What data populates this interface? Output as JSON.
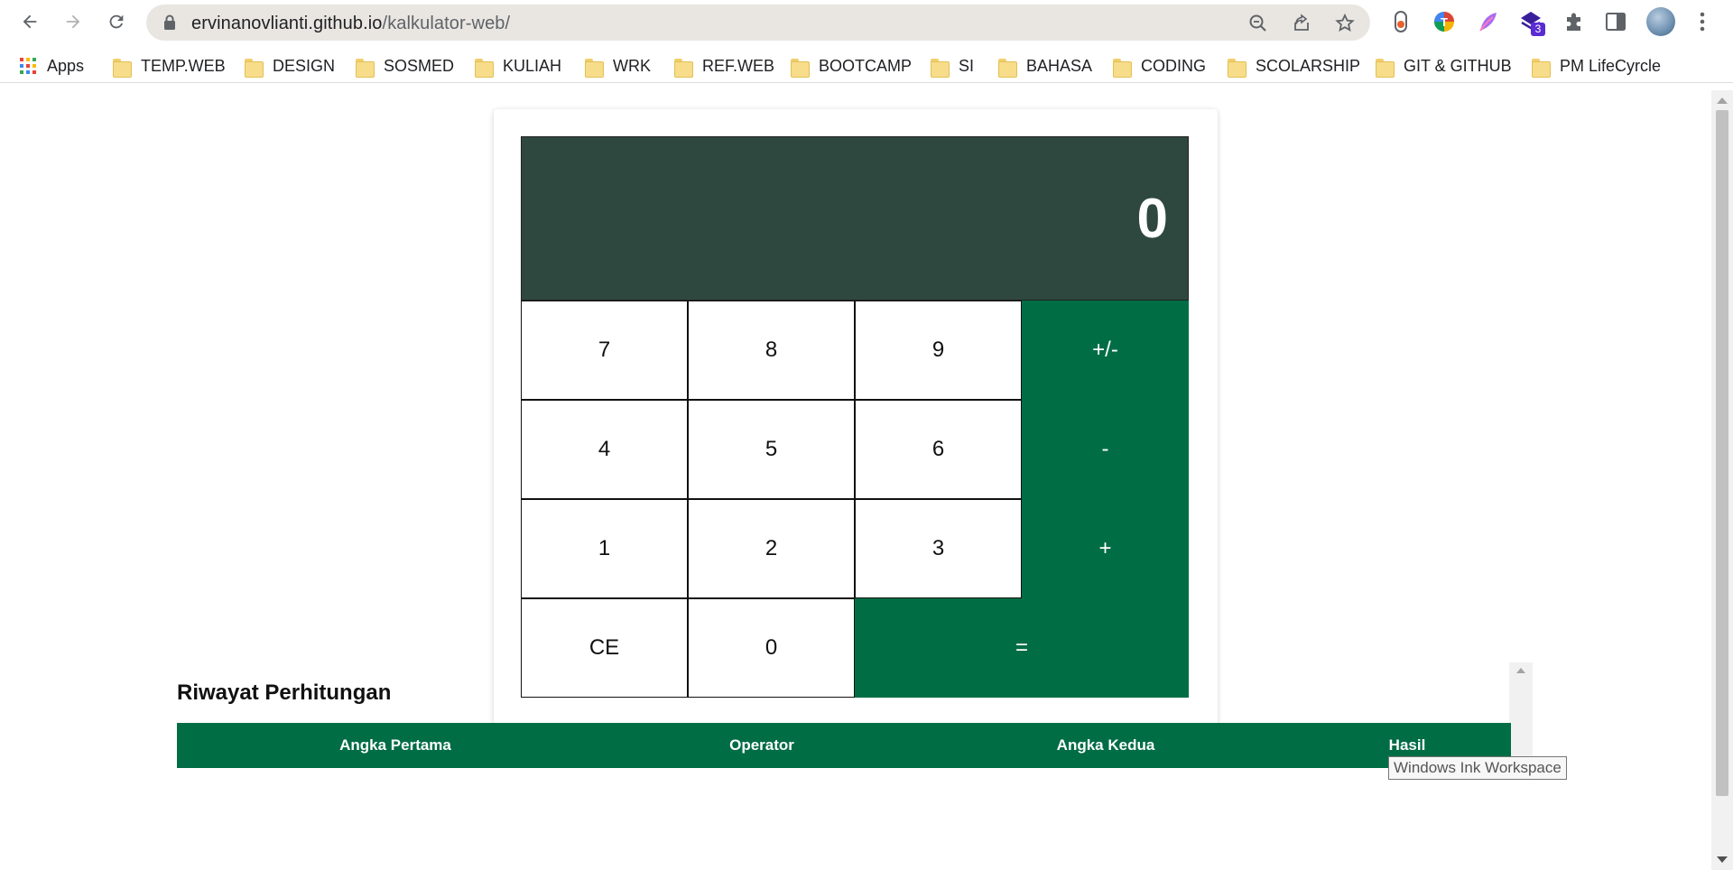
{
  "browser": {
    "url_host": "ervinanovlianti.github.io",
    "url_path": "/kalkulator-web/",
    "bookmarks": [
      {
        "label": "Apps",
        "icon": "apps-grid-icon"
      },
      {
        "label": "TEMP.WEB",
        "icon": "folder-icon"
      },
      {
        "label": "DESIGN",
        "icon": "folder-icon"
      },
      {
        "label": "SOSMED",
        "icon": "folder-icon"
      },
      {
        "label": "KULIAH",
        "icon": "folder-icon"
      },
      {
        "label": "WRK",
        "icon": "folder-icon"
      },
      {
        "label": "REF.WEB",
        "icon": "folder-icon"
      },
      {
        "label": "BOOTCAMP",
        "icon": "folder-icon"
      },
      {
        "label": "SI",
        "icon": "folder-icon"
      },
      {
        "label": "BAHASA",
        "icon": "folder-icon"
      },
      {
        "label": "CODING",
        "icon": "folder-icon"
      },
      {
        "label": "SCOLARSHIP",
        "icon": "folder-icon"
      },
      {
        "label": "GIT & GITHUB",
        "icon": "folder-icon"
      },
      {
        "label": "PM LifeCyrcle",
        "icon": "folder-icon"
      }
    ],
    "extension_badge": "3"
  },
  "calculator": {
    "display": "0",
    "keys": {
      "k7": "7",
      "k8": "8",
      "k9": "9",
      "negate": "+/-",
      "k4": "4",
      "k5": "5",
      "k6": "6",
      "minus": "-",
      "k1": "1",
      "k2": "2",
      "k3": "3",
      "plus": "+",
      "clear": "CE",
      "k0": "0",
      "equals": "="
    }
  },
  "history": {
    "title": "Riwayat Perhitungan",
    "columns": [
      "Angka Pertama",
      "Operator",
      "Angka Kedua",
      "Hasil"
    ]
  },
  "tooltip": "Windows Ink Workspace",
  "colors": {
    "display_bg": "#2e4840",
    "accent_green": "#006d45"
  }
}
